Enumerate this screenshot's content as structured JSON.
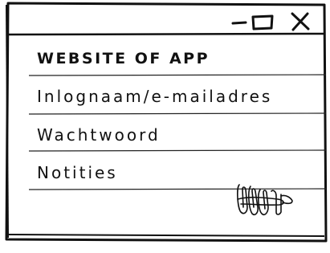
{
  "window": {
    "controls": [
      {
        "name": "minimize",
        "icon": "minimize-icon"
      },
      {
        "name": "maximize",
        "icon": "maximize-icon"
      },
      {
        "name": "close",
        "icon": "close-icon"
      }
    ]
  },
  "card": {
    "title": "WEBSITE OF APP",
    "fields": [
      {
        "label": "Inlognaam/e-mailadres"
      },
      {
        "label": "Wachtwoord"
      },
      {
        "label": "Notities"
      }
    ],
    "attachment_icon": "paperclips-icon"
  },
  "colors": {
    "ink": "#111111",
    "background": "#ffffff"
  }
}
